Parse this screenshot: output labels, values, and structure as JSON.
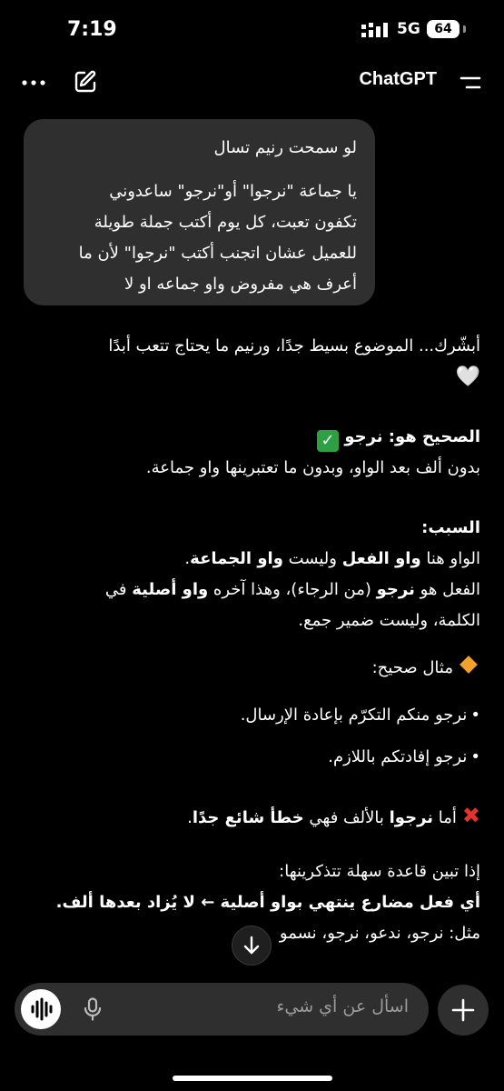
{
  "status_bar": {
    "time": "7:19",
    "network": "5G",
    "battery": "64"
  },
  "header": {
    "title": "ChatGPT"
  },
  "user_message": {
    "first_line": "لو سمحت رنيم تسال",
    "lines": [
      "يا جماعة \"نرجوا\" أو\"نرجو\" ساعدوني",
      "تكفون تعبت، كل يوم أكتب جملة طويلة",
      "للعميل عشان اتجنب أكتب \"نرجوا\" لأن ما",
      "أعرف هي مفروض واو جماعه او لا"
    ]
  },
  "assistant": {
    "intro": "أبشّرك... الموضوع بسيط جدًا، ورنيم ما يحتاج تتعب أبدًا",
    "heart": "🤍",
    "correct_heading": "الصحيح هو: نرجو",
    "correct_note": "بدون ألف بعد الواو، وبدون ما تعتبرينها واو جماعة.",
    "reason_title": "السبب:",
    "reason_l1": {
      "a": "الواو هنا ",
      "b": "واو الفعل",
      "c": " وليست ",
      "d": "واو الجماعة",
      "e": "."
    },
    "reason_l2": {
      "a": "الفعل هو ",
      "b": "نرجو",
      "c": " (من الرجاء)، وهذا آخره ",
      "d": "واو أصلية",
      "e": " في"
    },
    "reason_l3": "الكلمة، وليست ضمير جمع.",
    "example_title": "مثال صحيح:",
    "examples": [
      "نرجو منكم التكرّم بإعادة الإرسال.",
      "نرجو إفادتكم باللازم."
    ],
    "wrong": {
      "a": "أما ",
      "b": "نرجوا",
      "c": " بالألف فهي ",
      "d": "خطأ شائع جدًا",
      "e": "."
    },
    "rule_intro": "إذا تبين قاعدة سهلة تتذكرينها:",
    "rule": "أي فعل مضارع ينتهي بواو أصلية ← لا يُزاد بعدها ألف.",
    "rule_example": "مثل: نرجو، ندعو، نرجو، نسمو"
  },
  "composer": {
    "placeholder": "اسأل عن أي شيء"
  }
}
